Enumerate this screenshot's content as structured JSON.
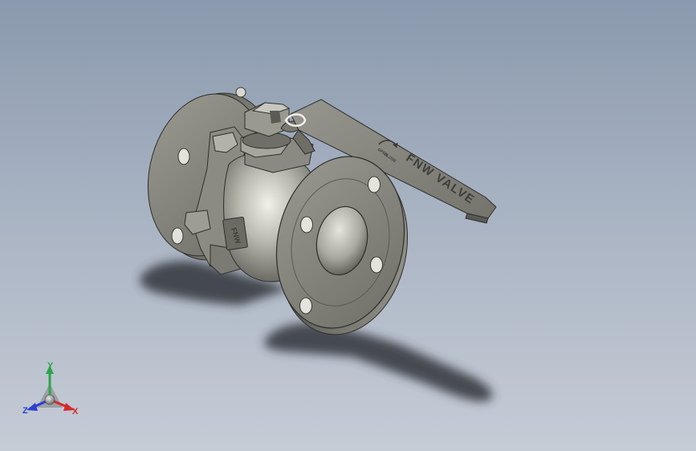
{
  "model": {
    "handle_text": "FNW VALVE",
    "body_plate_text": "FNW",
    "handle_direction_labels": [
      "OPEN",
      "CLOSE"
    ]
  },
  "triad": {
    "x_label": "X",
    "y_label": "Y",
    "z_label": "Z",
    "x_color": "#d42a2a",
    "y_color": "#2aa54a",
    "z_color": "#2a3fcf"
  },
  "colors": {
    "background_top": "#8a99ad",
    "background_bottom": "#c6ccd6",
    "metal": "#8a8a82",
    "shadow": "#33363b"
  }
}
